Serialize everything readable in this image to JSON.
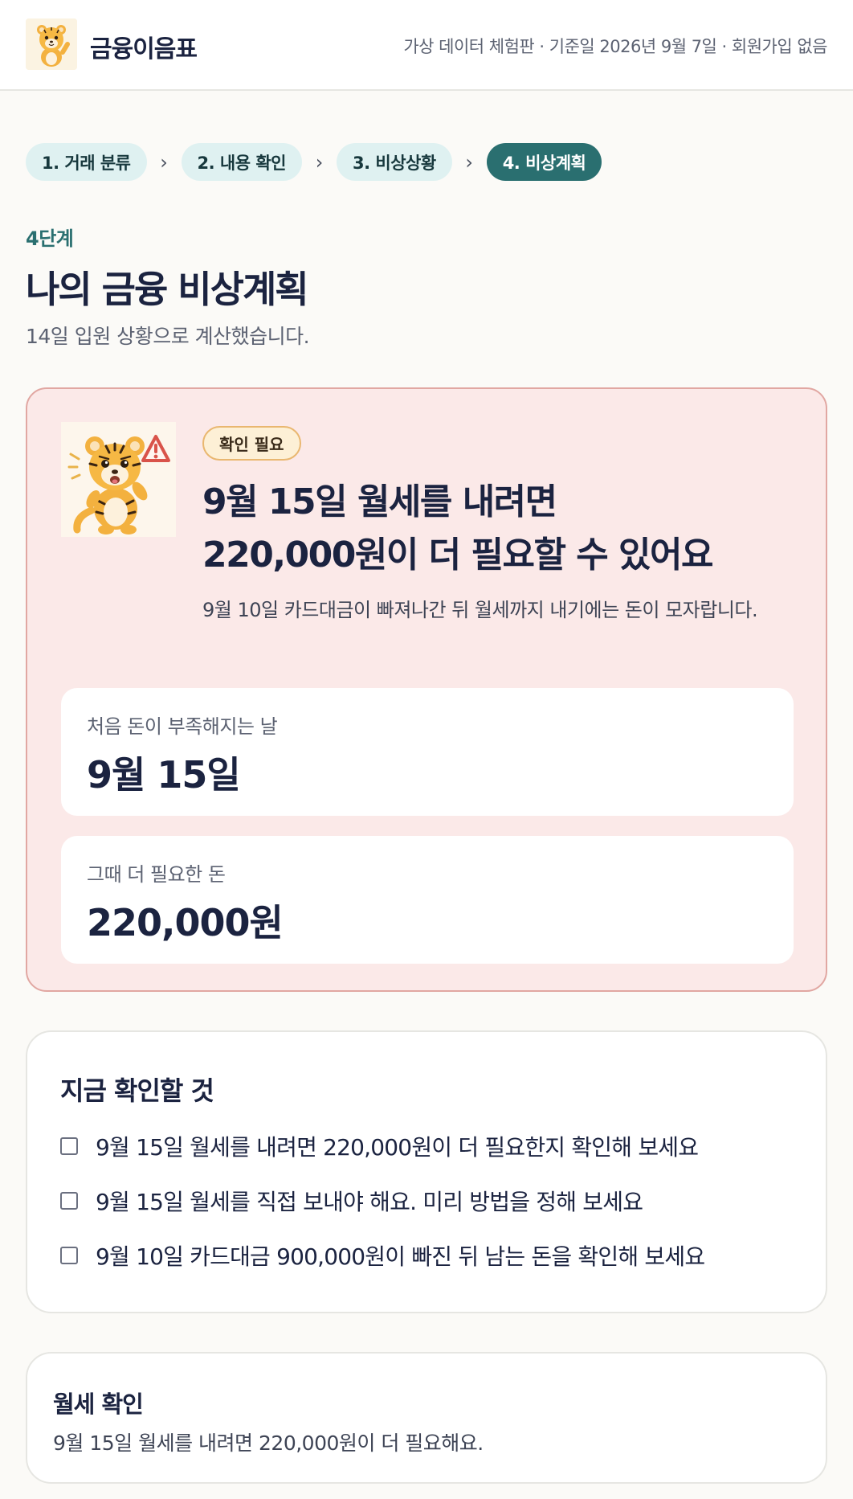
{
  "header": {
    "brand": "금융이음표",
    "meta": "가상 데이터 체험판 · 기준일 2026년 9월 7일 · 회원가입 없음",
    "logo_icon": "tiger-mascot-icon"
  },
  "steps": [
    {
      "label": "1. 거래 분류",
      "active": false
    },
    {
      "label": "2. 내용 확인",
      "active": false
    },
    {
      "label": "3. 비상상황",
      "active": false
    },
    {
      "label": "4. 비상계획",
      "active": true
    }
  ],
  "step_separator": "›",
  "page": {
    "eyebrow": "4단계",
    "title": "나의 금융 비상계획",
    "subtitle": "14일 입원 상황으로 계산했습니다."
  },
  "alert": {
    "icon": "worried-tiger-warning-icon",
    "badge": "확인 필요",
    "title_line1": "9월 15일 월세를 내려면",
    "title_line2": "220,000원이 더 필요할 수 있어요",
    "description": "9월 10일 카드대금이 빠져나간 뒤 월세까지 내기에는 돈이 모자랍니다.",
    "shortage_day_label": "처음 돈이 부족해지는 날",
    "shortage_day_value": "9월 15일",
    "needed_label": "그때 더 필요한 돈",
    "needed_value": "220,000원",
    "colors": {
      "background": "#fbe9e8",
      "border": "#e1a7a2",
      "badge_border": "#e9b770"
    }
  },
  "checklist": {
    "title": "지금 확인할 것",
    "items": [
      "9월 15일 월세를 내려면 220,000원이 더 필요한지 확인해 보세요",
      "9월 15일 월세를 직접 보내야 해요. 미리 방법을 정해 보세요",
      "9월 10일 카드대금 900,000원이 빠진 뒤 남는 돈을 확인해 보세요"
    ]
  },
  "rent": {
    "title": "월세 확인",
    "description": "9월 15일 월세를 내려면 220,000원이 더 필요해요."
  },
  "accent_color": "#2a6f70"
}
